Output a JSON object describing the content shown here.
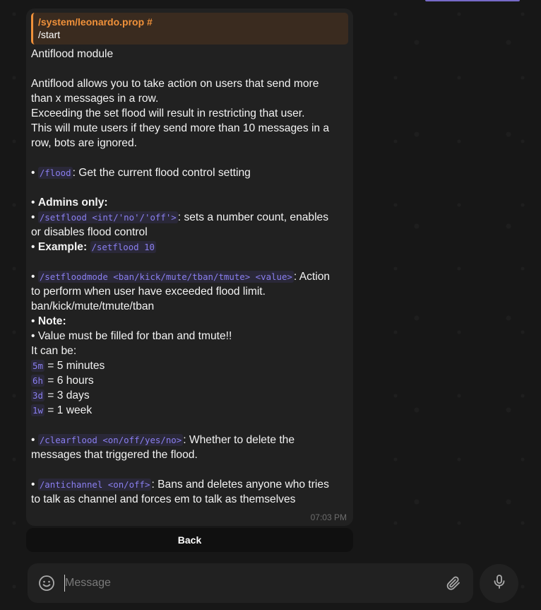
{
  "chat": {
    "reply": {
      "sender": "/system/leonardo.prop #",
      "text": "/start"
    },
    "message": {
      "title": "Antiflood module",
      "intro1": "Antiflood allows you to take action on users that send more",
      "intro2": "than x messages in a row.",
      "intro3": "Exceeding the set flood will result in restricting that user.",
      "intro4": "This will mute users if they send more than 10 messages in a",
      "intro5": "row, bots are ignored.",
      "bullet": "•",
      "flood_cmd": "/flood",
      "flood_desc": ": Get the current flood control setting",
      "admins_only": "Admins only:",
      "setflood_cmd": "/setflood <int/'no'/'off'>",
      "setflood_desc1": ": sets a number count, enables",
      "setflood_desc2": "or disables flood control",
      "example_label": "Example:",
      "example_cmd": "/setflood 10",
      "setfloodmode_cmd": "/setfloodmode <ban/kick/mute/tban/tmute> <value>",
      "setfloodmode_desc1": ": Action",
      "setfloodmode_desc2": "to perform when user have exceeded flood limit.",
      "setfloodmode_desc3": "ban/kick/mute/tmute/tban",
      "note_label": "Note:",
      "note_text": "Value must be filled for tban and tmute!!",
      "it_can_be": "It can be:",
      "durations": [
        {
          "code": "5m",
          "label": "= 5 minutes"
        },
        {
          "code": "6h",
          "label": "= 6 hours"
        },
        {
          "code": "3d",
          "label": "= 3 days"
        },
        {
          "code": "1w",
          "label": "= 1 week"
        }
      ],
      "clearflood_cmd": "/clearflood <on/off/yes/no>",
      "clearflood_desc1": ": Whether to delete the",
      "clearflood_desc2": "messages that triggered the flood.",
      "antichannel_cmd": "/antichannel <on/off>",
      "antichannel_desc1": ": Bans and deletes anyone who tries",
      "antichannel_desc2": "to talk as channel and forces em to talk as themselves",
      "time": "07:03 PM"
    },
    "inline_button": "Back"
  },
  "composer": {
    "placeholder": "Message",
    "value": ""
  },
  "icons": {
    "emoji": "smile-icon",
    "attach": "paperclip-icon",
    "mic": "microphone-icon"
  },
  "colors": {
    "accent": "#766ac8",
    "reply_accent": "#f0913a",
    "code": "#8a7ff0",
    "bubble": "#212121"
  }
}
